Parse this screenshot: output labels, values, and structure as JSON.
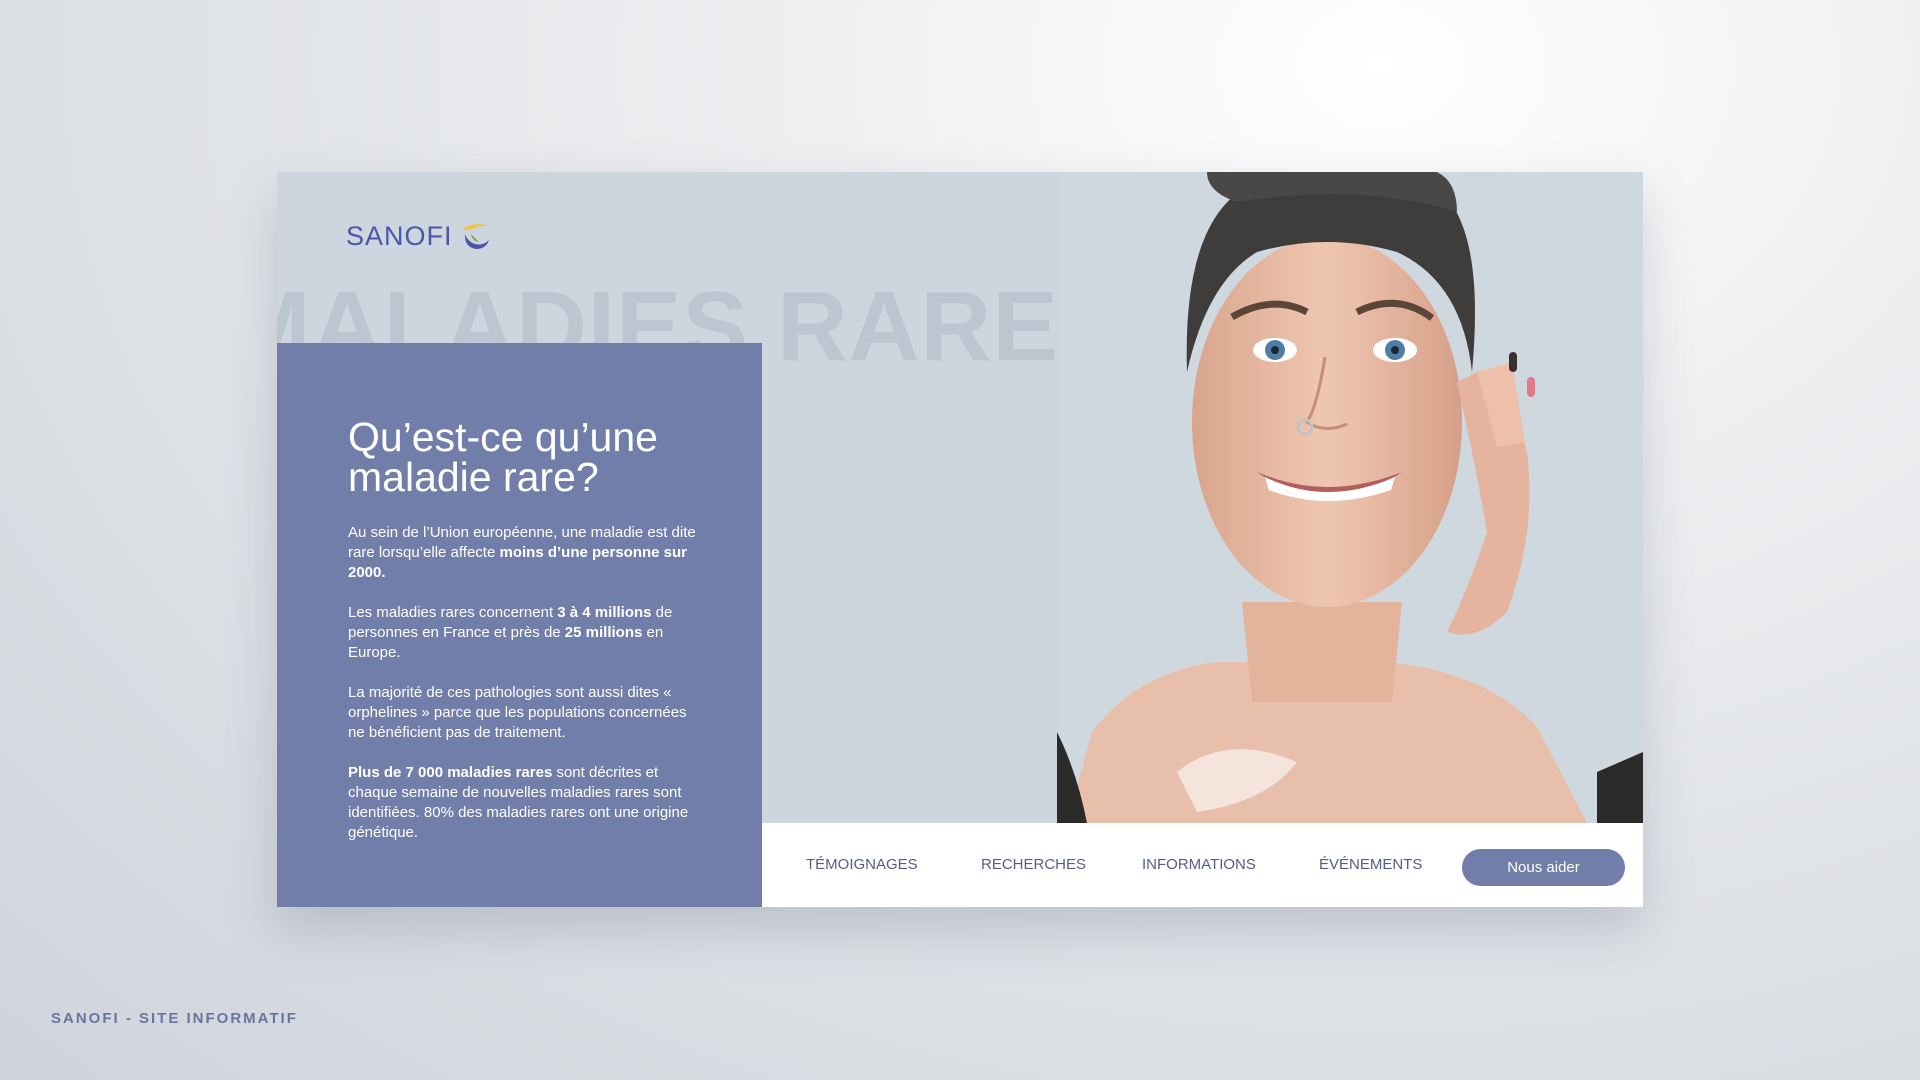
{
  "page": {
    "footer_caption": "SANOFI - SITE INFORMATIF"
  },
  "brand": {
    "logo_text": "SANOFI",
    "logo_icon": "sanofi-swirl-icon",
    "colors": {
      "primary": "#717ea9",
      "logo": "#4d55a8",
      "nav_text": "#545c8d",
      "card_background": "#cdd6de",
      "swirl_blue": "#4d55a8",
      "swirl_yellow": "#e9c64a"
    }
  },
  "hero": {
    "watermark": "MALADIES RARES"
  },
  "info": {
    "title": "Qu’est-ce qu’une maladie rare?",
    "p1_text1": "Au sein de l’Union européenne, une maladie est dite rare lorsqu’elle affecte ",
    "p1_bold1": "moins d’une personne sur 2000.",
    "p2_text1": "Les maladies rares concernent ",
    "p2_bold1": "3 à 4 millions",
    "p2_text2": " de personnes en France et près de ",
    "p2_bold2": "25 millions",
    "p2_text3": " en Europe.",
    "p3_text1": "La majorité de ces pathologies sont aussi dites « orphelines » parce que les populations concernées ne bénéficient pas de traitement.",
    "p4_bold1": "Plus de 7 000 maladies rares",
    "p4_text1": " sont décrites et chaque semaine de nouvelles maladies rares sont identifiées. 80% des maladies rares ont une origine génétique."
  },
  "nav": {
    "items": [
      {
        "label": "TÉMOIGNAGES"
      },
      {
        "label": "RECHERCHES"
      },
      {
        "label": "INFORMATIONS"
      },
      {
        "label": "ÉVÉNEMENTS"
      }
    ],
    "cta_label": "Nous aider"
  }
}
